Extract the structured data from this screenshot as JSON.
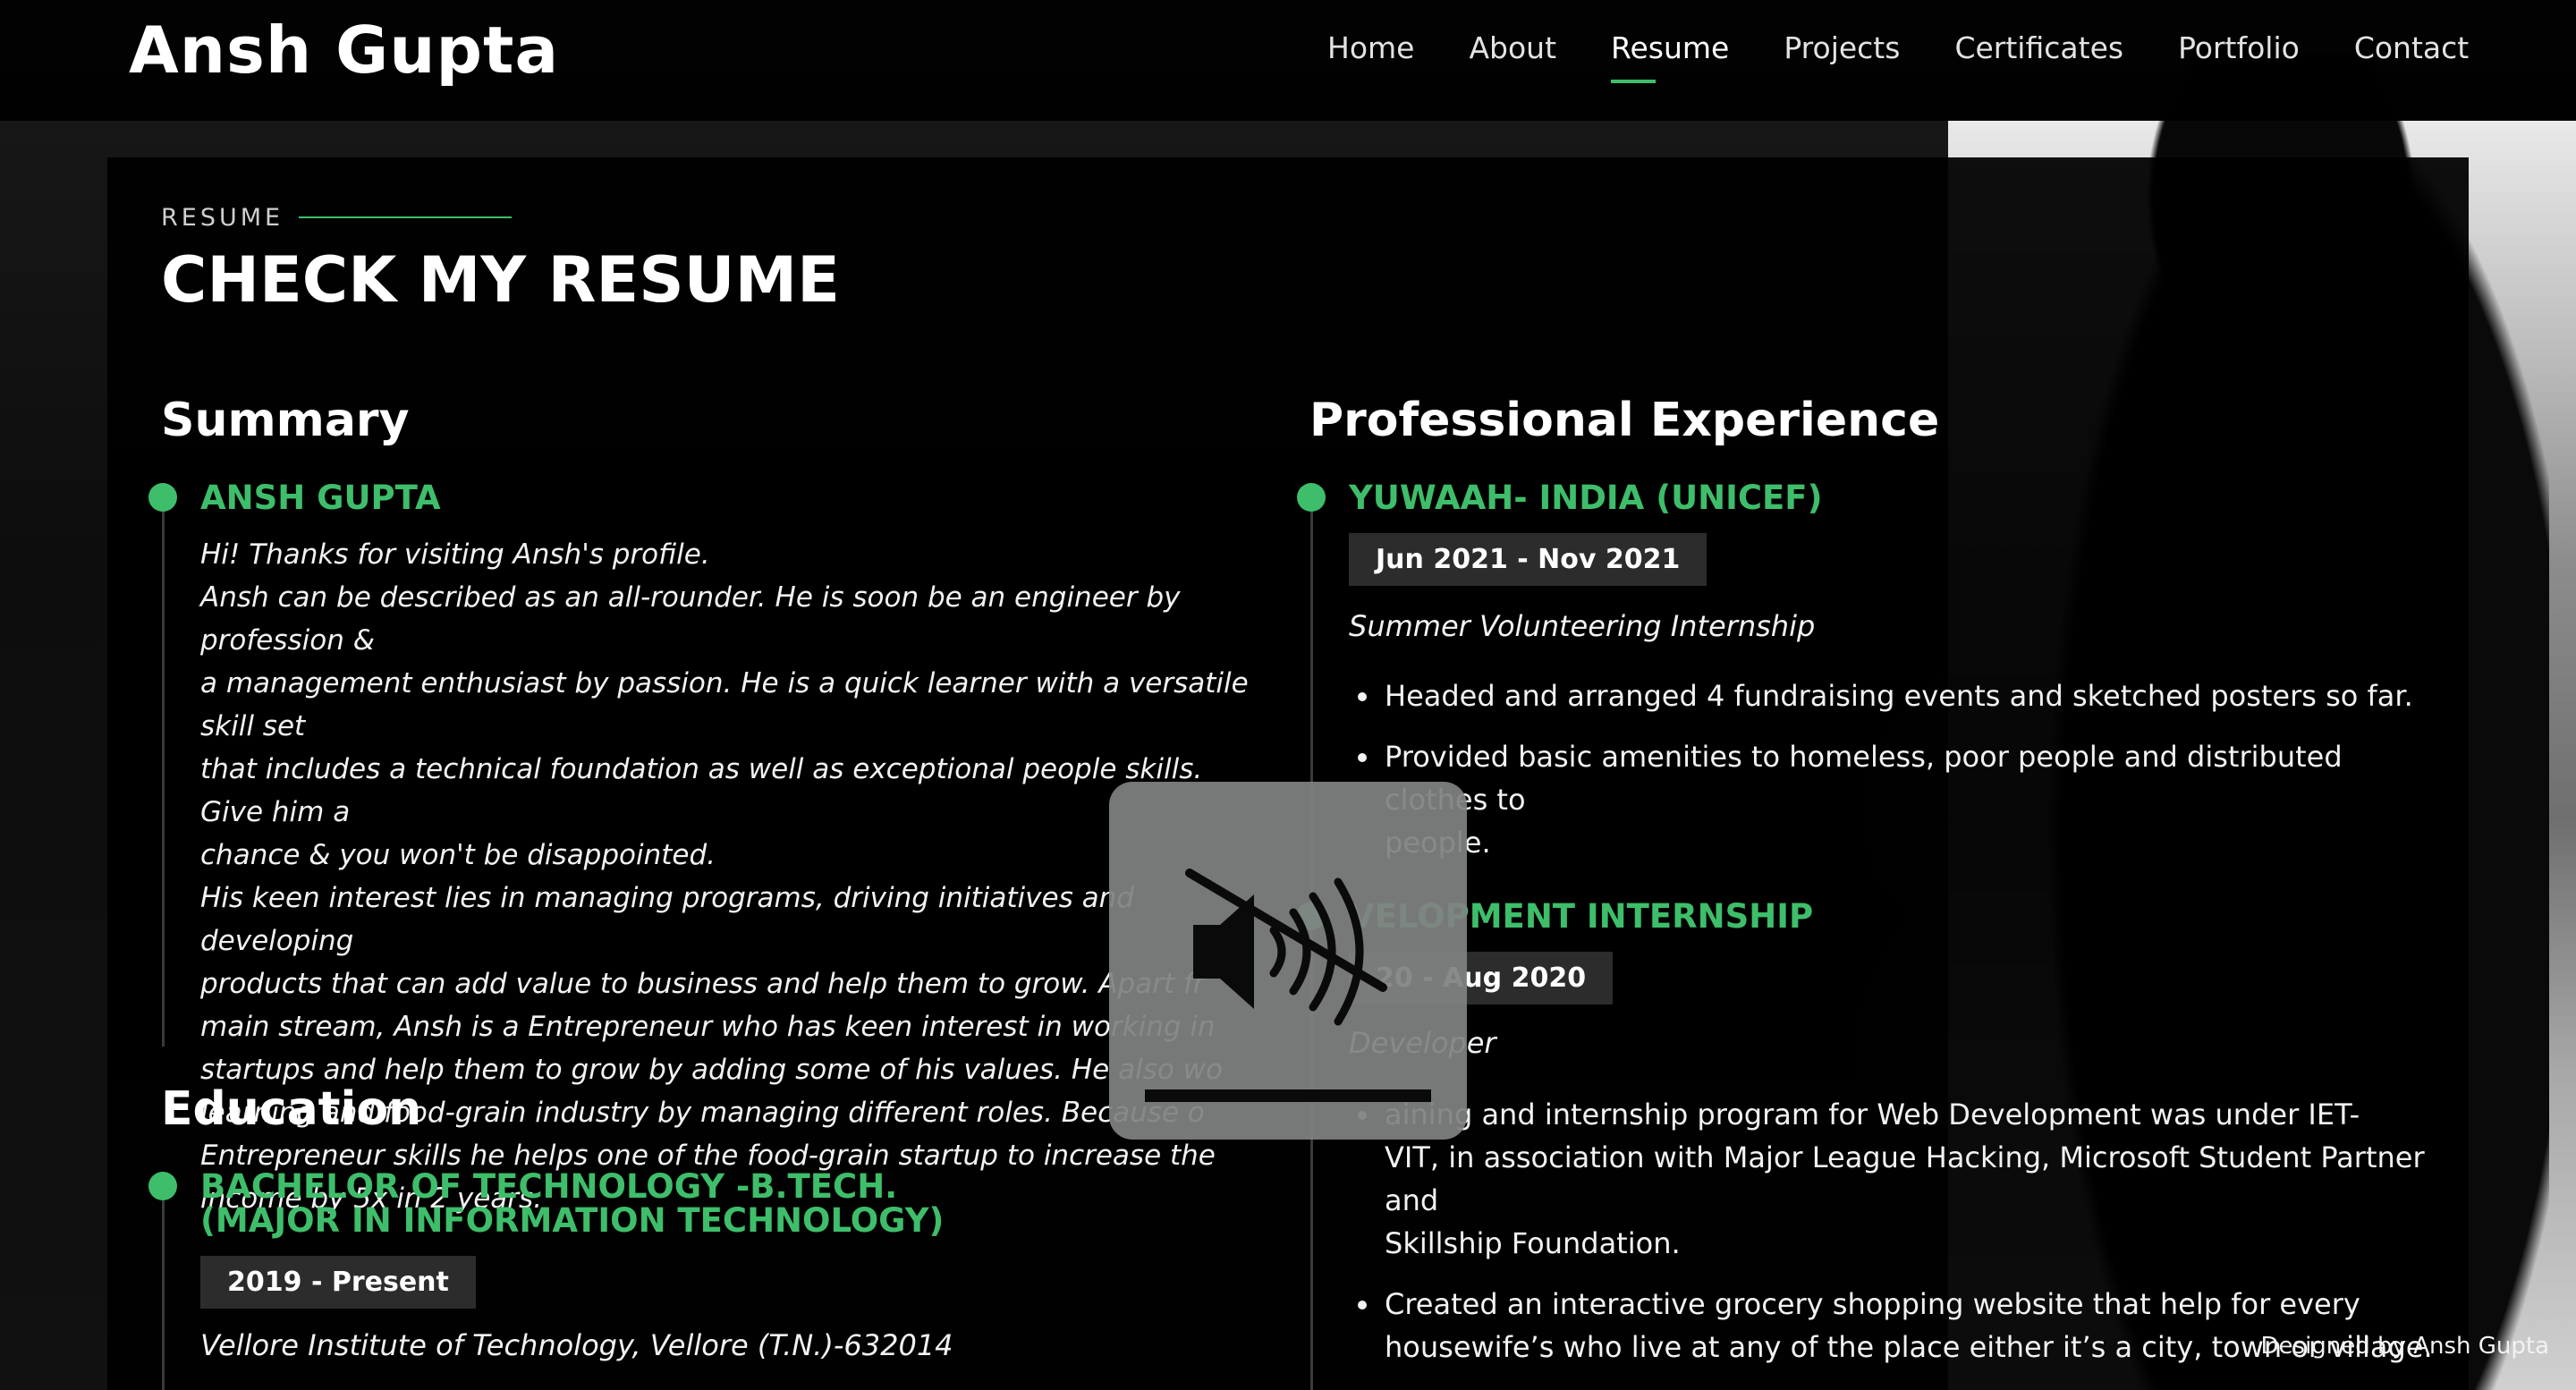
{
  "site": {
    "name": "Ansh Gupta"
  },
  "nav": {
    "items": [
      {
        "label": "Home"
      },
      {
        "label": "About"
      },
      {
        "label": "Resume"
      },
      {
        "label": "Projects"
      },
      {
        "label": "Certificates"
      },
      {
        "label": "Portfolio"
      },
      {
        "label": "Contact"
      }
    ],
    "active": "Resume"
  },
  "section": {
    "eyebrow": "RESUME",
    "title": "CHECK MY RESUME"
  },
  "summary": {
    "heading": "Summary",
    "name": "ANSH GUPTA",
    "lines": [
      "Hi! Thanks for visiting Ansh's profile.",
      "Ansh can be described as an all-rounder. He is soon be an engineer by profession &",
      "a management enthusiast by passion. He is a quick learner with a versatile skill set",
      "that includes a technical foundation as well as exceptional people skills. Give him a",
      "chance & you won't be disappointed.",
      "His keen interest lies in managing programs, driving initiatives and developing",
      "products that can add value to business and help them to grow. Apart fr",
      "main stream, Ansh is a Entrepreneur who has keen interest in working in",
      "startups and help them to grow by adding some of his values. He also wo",
      "learning and food-grain industry by managing different roles. Because o",
      "Entrepreneur skills he helps one of the food-grain startup to increase the",
      "income by 5x in 2 years."
    ]
  },
  "education": {
    "heading": "Education",
    "items": [
      {
        "title_line1": "BACHELOR OF TECHNOLOGY -B.TECH.",
        "title_line2": "(MAJOR IN INFORMATION TECHNOLOGY)",
        "date": "2019 - Present",
        "institution": "Vellore Institute of Technology, Vellore (T.N.)-632014"
      }
    ]
  },
  "experience": {
    "heading": "Professional Experience",
    "items": [
      {
        "title": "YUWAAH- INDIA (UNICEF)",
        "date": "Jun 2021 - Nov 2021",
        "role": "Summer Volunteering Internship",
        "bullets": [
          "Headed and arranged 4 fundraising events and sketched posters so far.",
          "Provided basic amenities to homeless, poor people and distributed clothes to",
          "people."
        ]
      },
      {
        "title": "VELOPMENT INTERNSHIP",
        "date": "20 - Aug 2020",
        "role": "Developer",
        "bullets": [
          "aining and internship program for Web Development was under IET-",
          "VIT, in association with Major League Hacking, Microsoft Student Partner and",
          "Skillship Foundation.",
          "Created an interactive grocery shopping website that help for every",
          "housewife’s who live at any of the place either it’s a city, town or village."
        ]
      }
    ]
  },
  "overlay": {
    "icon": "speaker-muted-icon",
    "volume_level": 1.0
  },
  "footer": {
    "credit": "Designed by Ansh Gupta"
  },
  "colors": {
    "accent": "#3ebe6a",
    "badge_bg": "#2c2c2c",
    "panel_bg": "#000000"
  }
}
